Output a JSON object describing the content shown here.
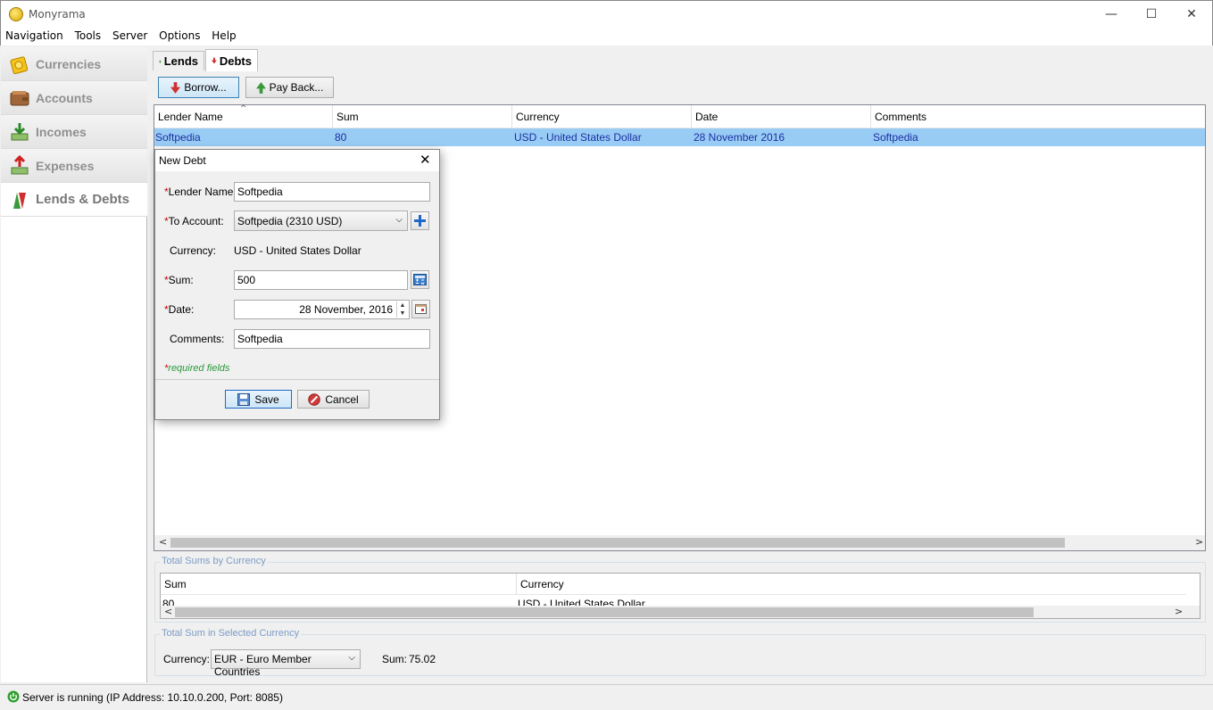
{
  "window": {
    "title": "Monyrama",
    "minimize": "—",
    "maximize": "☐",
    "close": "✕"
  },
  "menu": [
    "Navigation",
    "Tools",
    "Server",
    "Options",
    "Help"
  ],
  "sidebar": {
    "items": [
      {
        "label": "Currencies",
        "icon": "currencies-icon"
      },
      {
        "label": "Accounts",
        "icon": "wallet-icon"
      },
      {
        "label": "Incomes",
        "icon": "incomes-icon"
      },
      {
        "label": "Expenses",
        "icon": "expenses-icon"
      },
      {
        "label": "Lends & Debts",
        "icon": "lends-debts-icon",
        "active": true
      }
    ]
  },
  "tabs": {
    "lends": "Lends",
    "debts": "Debts",
    "active": "Debts"
  },
  "toolbar": {
    "borrow": "Borrow...",
    "payback": "Pay Back..."
  },
  "table": {
    "columns": [
      "Lender Name",
      "Sum",
      "Currency",
      "Date",
      "Comments"
    ],
    "rows": [
      [
        "Softpedia",
        "80",
        "USD - United States Dollar",
        "28 November 2016",
        "Softpedia"
      ]
    ]
  },
  "totals": {
    "group_label": "Total Sums by Currency",
    "columns": [
      "Sum",
      "Currency"
    ],
    "row": [
      "80",
      "USD - United States Dollar"
    ]
  },
  "selected_total": {
    "group_label": "Total Sum in Selected Currency",
    "currency_label": "Currency:",
    "currency_value": "EUR - Euro Member Countries",
    "sum_label": "Sum:",
    "sum_value": "75.02"
  },
  "dialog": {
    "title": "New Debt",
    "lender_label": "Lender Name:",
    "lender_value": "Softpedia",
    "account_label": "To Account:",
    "account_value": "Softpedia (2310 USD)",
    "currency_label": "Currency:",
    "currency_value": "USD - United States Dollar",
    "sum_label": "Sum:",
    "sum_value": "500",
    "date_label": "Date:",
    "date_value": "28 November, 2016",
    "comments_label": "Comments:",
    "comments_value": "Softpedia",
    "required_note": "required fields",
    "asterisk": "*",
    "save": "Save",
    "cancel": "Cancel"
  },
  "status": {
    "text": "Server is running (IP Address: 10.10.0.200, Port: 8085)"
  },
  "colors": {
    "selection": "#99ccf5",
    "link_text": "#1a2fa0",
    "group_label": "#7a9cc7",
    "required": "#d00000",
    "note": "#2a9a3a"
  }
}
